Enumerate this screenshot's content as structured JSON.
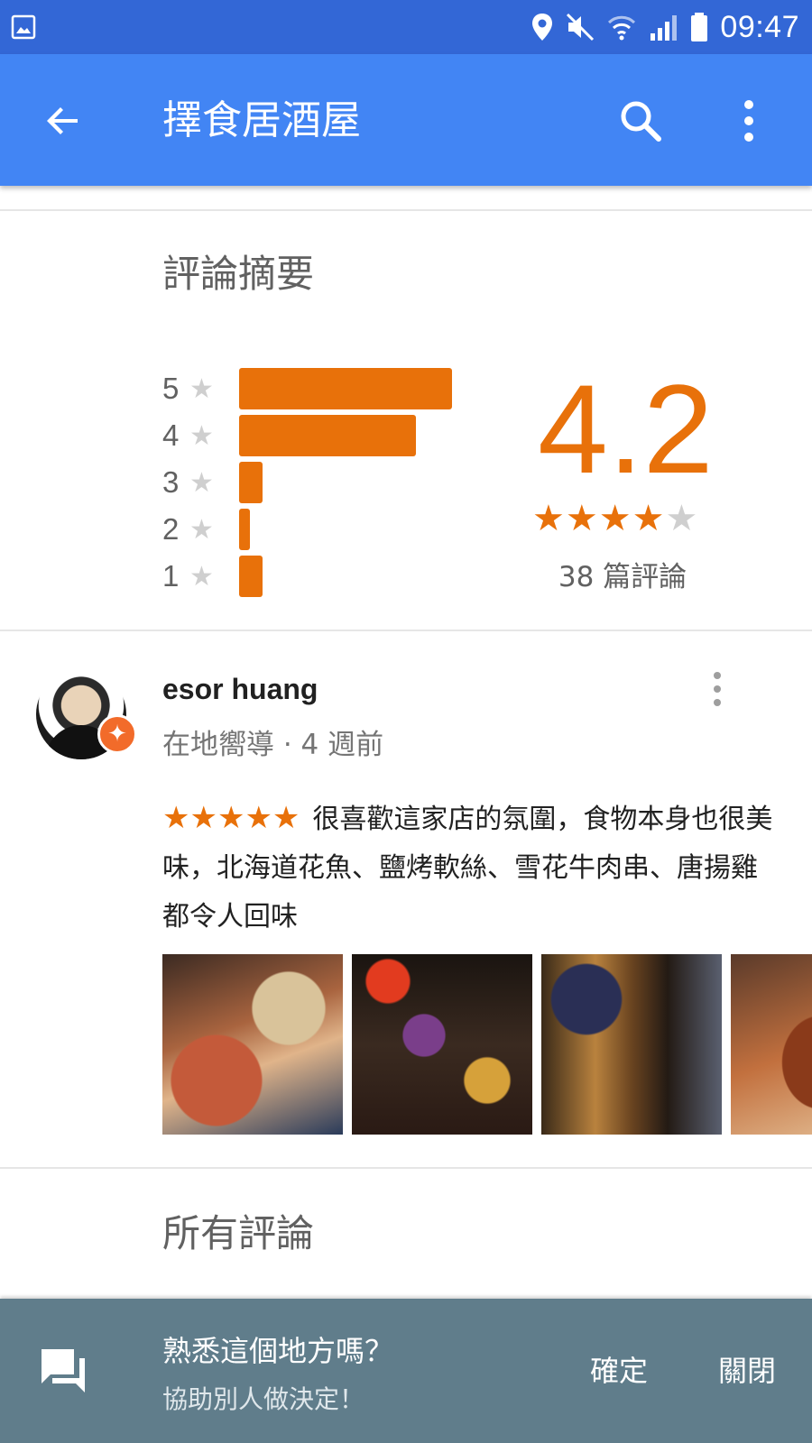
{
  "status_bar": {
    "time": "09:47",
    "icons": [
      "gallery-icon",
      "location-icon",
      "mute-icon",
      "wifi-icon",
      "signal-icon",
      "battery-icon"
    ]
  },
  "app_bar": {
    "title": "擇食居酒屋",
    "icons": [
      "back-arrow-icon",
      "search-icon",
      "more-vert-icon"
    ]
  },
  "summary": {
    "title": "評論摘要",
    "rating": "4.2",
    "rating_value": 4.2,
    "stars_display": "★★★★★",
    "review_count": "38 篇評論",
    "histogram": [
      {
        "stars": "5",
        "star_glyph": "★",
        "fraction": 1.0
      },
      {
        "stars": "4",
        "star_glyph": "★",
        "fraction": 0.83
      },
      {
        "stars": "3",
        "star_glyph": "★",
        "fraction": 0.11
      },
      {
        "stars": "2",
        "star_glyph": "★",
        "fraction": 0.05
      },
      {
        "stars": "1",
        "star_glyph": "★",
        "fraction": 0.11
      }
    ]
  },
  "review": {
    "name": "esor huang",
    "meta": "在地嚮導 · 4 週前",
    "stars": "★★★★★",
    "rating_value": 5,
    "text": "很喜歡這家店的氛圍，食物本身也很美味，北海道花魚、鹽烤軟絲、雪花牛肉串、唐揚雞都令人回味",
    "badge_icon": "local-guide-icon"
  },
  "all_reviews": {
    "title": "所有評論"
  },
  "bottom_bar": {
    "question": "熟悉這個地方嗎？",
    "subtitle": "協助別人做決定！",
    "confirm": "確定",
    "close": "關閉",
    "icon": "feedback-chat-icon"
  },
  "colors": {
    "status_bar": "#3367d6",
    "app_bar": "#4285f4",
    "accent_orange": "#e8710a",
    "bottom_bar": "#607d8b"
  }
}
